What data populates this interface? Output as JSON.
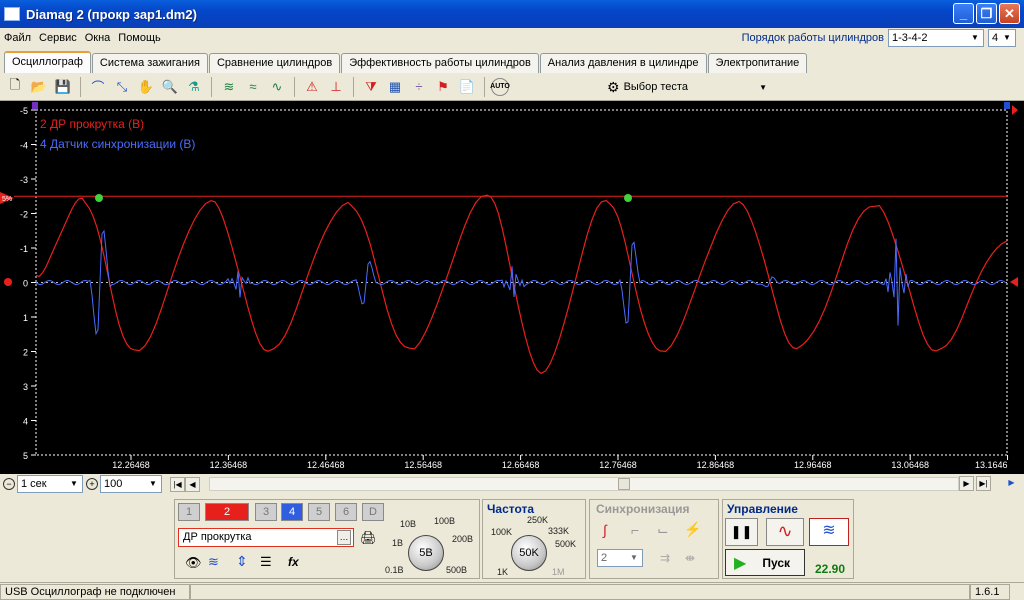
{
  "window": {
    "title": "Diamag 2 (прокр зар1.dm2)"
  },
  "menu": [
    "Файл",
    "Сервис",
    "Окна",
    "Помощь"
  ],
  "firing_order": {
    "label": "Порядок работы цилиндров",
    "value": "1-3-4-2",
    "count": "4"
  },
  "tabs": [
    "Осциллограф",
    "Система зажигания",
    "Сравнение цилиндров",
    "Эффективность работы цилиндров",
    "Анализ давления в цилиндре",
    "Электропитание"
  ],
  "toolbar": {
    "test_select": "Выбор теста",
    "auto_label": "AUTO"
  },
  "scope": {
    "legend": [
      {
        "text": "2 ДР прокрутка (В)",
        "color": "#e8201c"
      },
      {
        "text": "4 Датчик синхронизации (В)",
        "color": "#4a6cff"
      }
    ],
    "y_ticks": [
      "-5",
      "-4",
      "-3",
      "-2",
      "-1",
      "0",
      "1",
      "2",
      "3",
      "4",
      "5"
    ],
    "x_ticks": [
      "12.26468",
      "12.36468",
      "12.46468",
      "12.56468",
      "12.66468",
      "12.76468",
      "12.86468",
      "12.96468",
      "13.06468",
      "13.1646"
    ],
    "trigger_marker": "5%"
  },
  "controls": {
    "time_div": "1 сек",
    "zoom": "100"
  },
  "channels": {
    "buttons": [
      "1",
      "2",
      "3",
      "4",
      "5",
      "6",
      "D"
    ],
    "name": "ДР прокрутка",
    "volt_labels": [
      "10В",
      "100В",
      "200В",
      "500В",
      "0.1В",
      "1В"
    ],
    "volt_value": "5В"
  },
  "frequency": {
    "title": "Частота",
    "labels": [
      "250K",
      "100K",
      "333K",
      "500K",
      "1K",
      "1M"
    ],
    "value": "50K"
  },
  "sync": {
    "title": "Синхронизация",
    "value": "2"
  },
  "control": {
    "title": "Управление",
    "start": "Пуск",
    "fps": "22.90"
  },
  "status": {
    "text": "USB Осциллограф не подключен",
    "version": "1.6.1"
  },
  "colors": {
    "ch2": "#e8201c",
    "ch4": "#4a6cff",
    "trigger_line": "#e8201c",
    "grid": "#ffffff"
  }
}
